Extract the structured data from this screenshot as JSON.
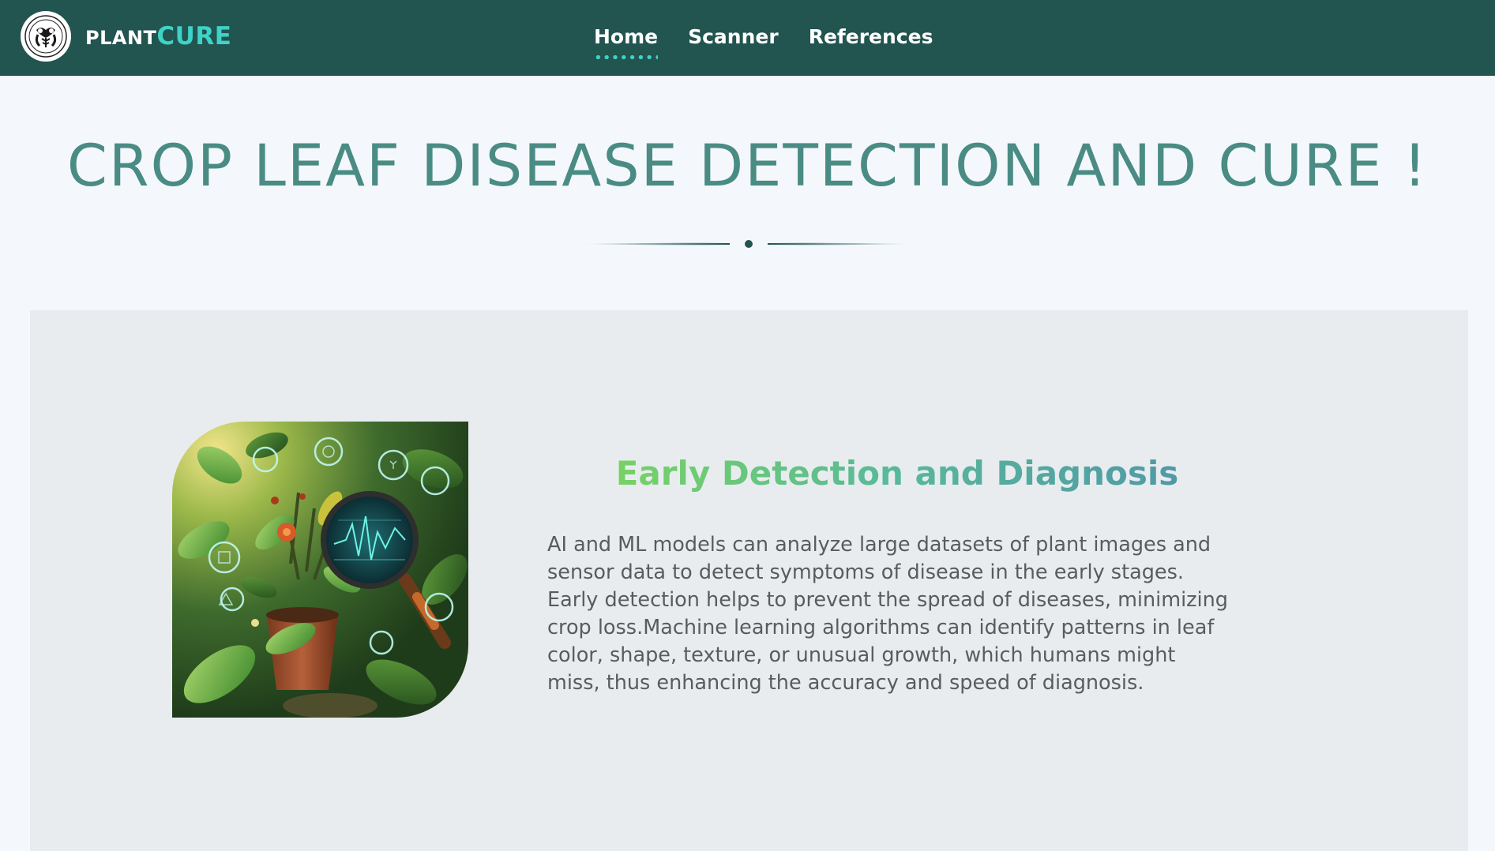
{
  "navbar": {
    "brand_plant": "PLANT",
    "brand_cure": "CURE",
    "links": [
      {
        "label": "Home",
        "active": true
      },
      {
        "label": "Scanner",
        "active": false
      },
      {
        "label": "References",
        "active": false
      }
    ]
  },
  "hero": {
    "title": "CROP LEAF DISEASE DETECTION AND CURE !"
  },
  "feature": {
    "title": "Early Detection and Diagnosis",
    "description": "AI and ML models can analyze large datasets of plant images and sensor data to detect symptoms of disease in the early stages. Early detection helps to prevent the spread of diseases, minimizing crop loss.Machine learning algorithms can identify patterns in leaf color, shape, texture, or unusual growth, which humans might miss, thus enhancing the accuracy and speed of diagnosis.",
    "image_icon": "plant-magnifier-illustration"
  },
  "colors": {
    "navbar_bg": "#225450",
    "accent_teal": "#3fd2c7",
    "hero_title": "#4a8c84",
    "page_bg": "#f4f8fc",
    "panel_bg": "#e8ecef",
    "feature_title_gradient_start": "#7ed957",
    "feature_title_gradient_end": "#4f92a8",
    "body_text": "#5b5b5b"
  }
}
